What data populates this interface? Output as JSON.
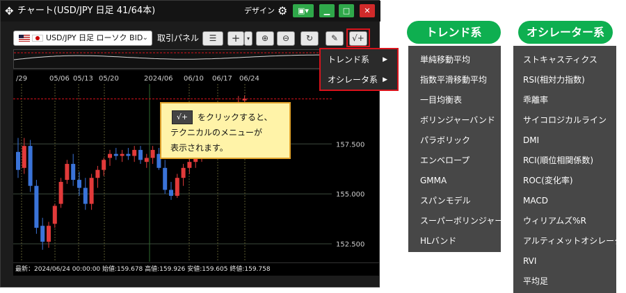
{
  "window": {
    "move_icon": "✥",
    "title": "チャート(USD/JPY 日足 41/64本)",
    "design_label": "デザイン",
    "gear_icon": "⚙",
    "layout_icon": "▣▾",
    "minimize_icon": "▁",
    "maximize_icon": "□",
    "close_icon": "✕"
  },
  "toolbar": {
    "pair_label": "USD/JPY 日足 ローソク BID",
    "pair_caret": "⌄",
    "trade_panel_label": "取引パネル",
    "lines_icon": "☰",
    "plus_icon": "+",
    "plus_dropdown_icon": "▾",
    "zoom_in_icon": "⊕",
    "zoom_out_icon": "⊖",
    "reload_icon": "↻",
    "pen_icon": "✎",
    "technical_icon": "√+"
  },
  "context_menu": {
    "items": [
      {
        "label": "トレンド系",
        "arrow": "▶"
      },
      {
        "label": "オシレータ系",
        "arrow": "▶"
      }
    ]
  },
  "tooltip": {
    "icon": "√+",
    "line1": "をクリックすると、",
    "line2": "テクニカルのメニューが",
    "line3": "表示されます。"
  },
  "status": {
    "text": "最新：2024/06/24 00:00:00 始値:159.678 高値:159.926 安値:159.605 終値:159.758"
  },
  "chart_data": {
    "type": "candlestick",
    "x_tick_labels": [
      "/29",
      "05/06",
      "05/13",
      "05/20",
      "2024/06",
      "06/10",
      "06/17",
      "06/24"
    ],
    "y_tick_labels": [
      "157.500",
      "155.000",
      "152.500"
    ],
    "y_ticks": [
      157.5,
      155.0,
      152.5
    ],
    "ylim": [
      151.6,
      160.5
    ],
    "latest": {
      "date": "2024/06/24",
      "open": 159.678,
      "high": 159.926,
      "low": 159.605,
      "close": 159.758
    },
    "colors": {
      "up": "#e23a3a",
      "down": "#3a73d8",
      "grid": "#3f5f3f"
    },
    "candles": [
      {
        "o": 157.1,
        "h": 157.8,
        "l": 155.8,
        "c": 156.2
      },
      {
        "o": 156.3,
        "h": 157.8,
        "l": 156.0,
        "c": 157.4
      },
      {
        "o": 157.4,
        "h": 157.7,
        "l": 155.1,
        "c": 155.4
      },
      {
        "o": 155.4,
        "h": 155.7,
        "l": 153.0,
        "c": 153.3
      },
      {
        "o": 153.4,
        "h": 153.8,
        "l": 152.2,
        "c": 152.6
      },
      {
        "o": 152.6,
        "h": 153.6,
        "l": 152.3,
        "c": 153.4
      },
      {
        "o": 153.5,
        "h": 154.5,
        "l": 153.3,
        "c": 154.4
      },
      {
        "o": 154.5,
        "h": 155.8,
        "l": 154.3,
        "c": 155.6
      },
      {
        "o": 155.7,
        "h": 156.7,
        "l": 155.5,
        "c": 156.5
      },
      {
        "o": 156.5,
        "h": 157.0,
        "l": 155.4,
        "c": 155.7
      },
      {
        "o": 155.7,
        "h": 156.1,
        "l": 154.9,
        "c": 155.3
      },
      {
        "o": 155.3,
        "h": 155.8,
        "l": 154.2,
        "c": 154.5
      },
      {
        "o": 154.5,
        "h": 156.0,
        "l": 154.2,
        "c": 155.8
      },
      {
        "o": 155.8,
        "h": 156.4,
        "l": 155.3,
        "c": 156.2
      },
      {
        "o": 156.2,
        "h": 156.8,
        "l": 155.9,
        "c": 156.7
      },
      {
        "o": 156.8,
        "h": 157.2,
        "l": 156.4,
        "c": 157.0
      },
      {
        "o": 157.0,
        "h": 157.3,
        "l": 156.7,
        "c": 156.9
      },
      {
        "o": 156.9,
        "h": 157.2,
        "l": 156.6,
        "c": 157.0
      },
      {
        "o": 157.0,
        "h": 157.3,
        "l": 156.7,
        "c": 156.9
      },
      {
        "o": 156.9,
        "h": 157.4,
        "l": 156.6,
        "c": 157.2
      },
      {
        "o": 157.2,
        "h": 157.4,
        "l": 156.5,
        "c": 156.7
      },
      {
        "o": 156.6,
        "h": 157.0,
        "l": 156.3,
        "c": 156.8
      },
      {
        "o": 156.8,
        "h": 157.4,
        "l": 156.5,
        "c": 157.2
      },
      {
        "o": 157.0,
        "h": 157.3,
        "l": 156.2,
        "c": 156.3
      },
      {
        "o": 156.3,
        "h": 156.7,
        "l": 155.0,
        "c": 155.2
      },
      {
        "o": 155.2,
        "h": 155.6,
        "l": 154.7,
        "c": 154.9
      },
      {
        "o": 154.9,
        "h": 156.0,
        "l": 154.8,
        "c": 155.8
      },
      {
        "o": 155.8,
        "h": 156.5,
        "l": 155.4,
        "c": 156.3
      },
      {
        "o": 156.3,
        "h": 156.8,
        "l": 156.0,
        "c": 156.6
      },
      {
        "o": 156.6,
        "h": 157.1,
        "l": 156.3,
        "c": 156.9
      },
      {
        "o": 156.9,
        "h": 157.4,
        "l": 156.6,
        "c": 157.2
      },
      {
        "o": 157.2,
        "h": 157.7,
        "l": 157.0,
        "c": 157.4
      },
      {
        "o": 157.4,
        "h": 157.9,
        "l": 157.1,
        "c": 157.7
      },
      {
        "o": 157.7,
        "h": 158.3,
        "l": 157.4,
        "c": 158.1
      },
      {
        "o": 158.1,
        "h": 158.6,
        "l": 157.8,
        "c": 158.4
      },
      {
        "o": 158.4,
        "h": 159.2,
        "l": 158.2,
        "c": 159.0
      },
      {
        "o": 159.0,
        "h": 159.9,
        "l": 158.8,
        "c": 159.6
      },
      {
        "o": 159.678,
        "h": 159.926,
        "l": 159.605,
        "c": 159.758
      }
    ]
  },
  "trend_panel": {
    "title": "トレンド系",
    "items": [
      "単純移動平均",
      "指数平滑移動平均",
      "一目均衡表",
      "ボリンジャーバンド",
      "パラボリック",
      "エンベロープ",
      "GMMA",
      "スパンモデル",
      "スーパーボリンジャー",
      "HLバンド"
    ]
  },
  "oscillator_panel": {
    "title": "オシレーター系",
    "items": [
      "ストキャスティクス",
      "RSI(相対力指数)",
      "乖離率",
      "サイコロジカルライン",
      "DMI",
      "RCI(順位相関係数)",
      "ROC(変化率)",
      "MACD",
      "ウィリアムズ%R",
      "アルティメットオシレーター",
      "RVI",
      "平均足"
    ]
  }
}
